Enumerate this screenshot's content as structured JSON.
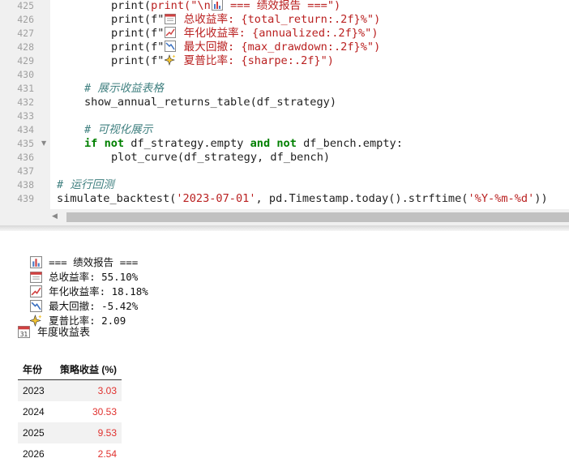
{
  "editor": {
    "lines": [
      {
        "num": "425",
        "fold": false
      },
      {
        "num": "426",
        "fold": false
      },
      {
        "num": "427",
        "fold": false
      },
      {
        "num": "428",
        "fold": false
      },
      {
        "num": "429",
        "fold": false
      },
      {
        "num": "430",
        "fold": false
      },
      {
        "num": "431",
        "fold": false
      },
      {
        "num": "432",
        "fold": false
      },
      {
        "num": "433",
        "fold": false
      },
      {
        "num": "434",
        "fold": false
      },
      {
        "num": "435",
        "fold": true
      },
      {
        "num": "436",
        "fold": false
      },
      {
        "num": "437",
        "fold": false
      },
      {
        "num": "438",
        "fold": false
      },
      {
        "num": "439",
        "fold": false
      }
    ],
    "code": {
      "l425a": "print(\"\\n",
      "l425b": " === 绩效报告 ===\")",
      "l426a": "print(f\"",
      "l426b": " 总收益率: {total_return:.2f}%\")",
      "l427a": "print(f\"",
      "l427b": " 年化收益率: {annualized:.2f}%\")",
      "l428a": "print(f\"",
      "l428b": " 最大回撤: {max_drawdown:.2f}%\")",
      "l429a": "print(f\"",
      "l429b": " 夏普比率: {sharpe:.2f}\")",
      "l431": "# 展示收益表格",
      "l432": "show_annual_returns_table(df_strategy)",
      "l434": "# 可视化展示",
      "l435_kw1": "if",
      "l435_kw2": "not",
      "l435_t1": " df_strategy.empty ",
      "l435_kw3": "and",
      "l435_kw4": "not",
      "l435_t2": " df_bench.empty:",
      "l436": "plot_curve(df_strategy, df_bench)",
      "l438": "# 运行回测",
      "l439a": "simulate_backtest(",
      "l439b": "'2023-07-01'",
      "l439c": ", pd.Timestamp.today().strftime(",
      "l439d": "'%Y-%m-%d'",
      "l439e": "))"
    },
    "scroll_arrow": "◀"
  },
  "output": {
    "report_header": "=== 绩效报告 ===",
    "total_return": "总收益率: 55.10%",
    "annualized": "年化收益率: 18.18%",
    "max_drawdown": "最大回撤: -5.42%",
    "sharpe": "夏普比率: 2.09",
    "annual_title": "年度收益表",
    "calendar_day": "31",
    "table": {
      "headers": [
        "年份",
        "策略收益 (%)"
      ],
      "rows": [
        {
          "year": "2023",
          "value": "3.03"
        },
        {
          "year": "2024",
          "value": "30.53"
        },
        {
          "year": "2025",
          "value": "9.53"
        },
        {
          "year": "2026",
          "value": "2.54"
        }
      ]
    }
  },
  "colors": {
    "keyword": "#008000",
    "string": "#ba2121",
    "comment": "#408080",
    "negative_value": "#e0312e"
  },
  "icons": [
    "bar-chart-icon",
    "calendar-icon",
    "chart-up-icon",
    "chart-down-icon",
    "sparkles-icon"
  ]
}
